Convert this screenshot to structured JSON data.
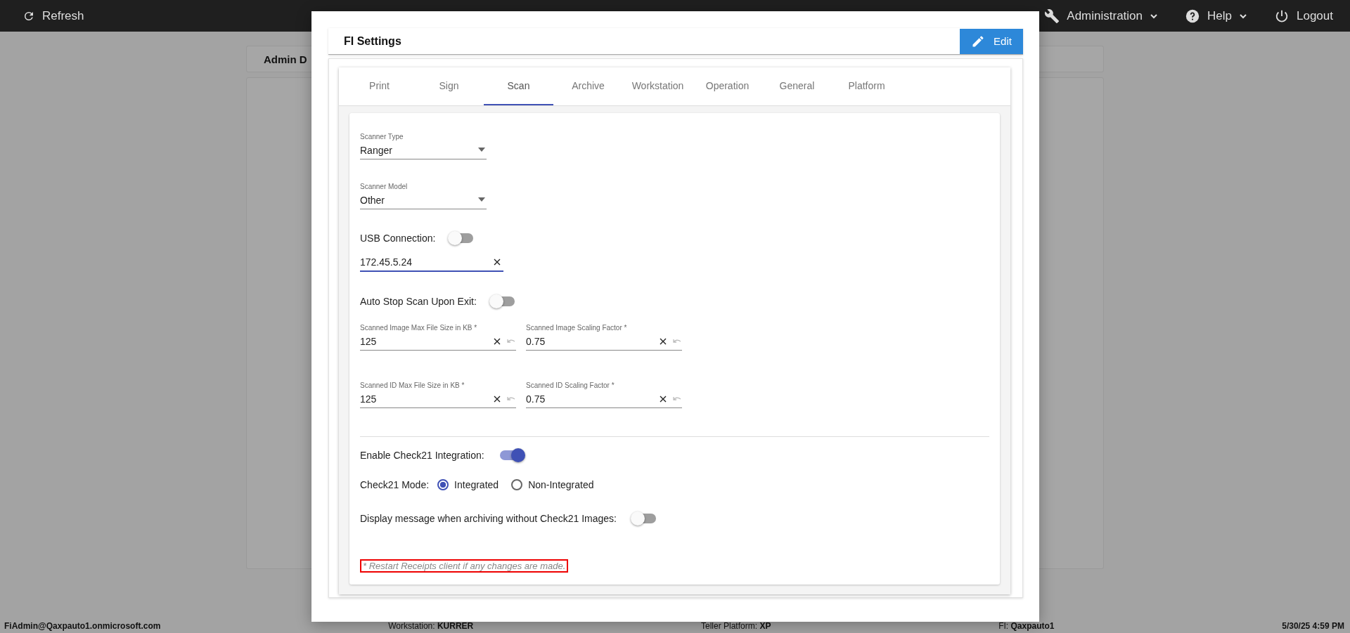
{
  "top_bar": {
    "refresh": "Refresh",
    "menus": [
      {
        "kind": "wrench",
        "label": "Administration",
        "dropdown": true
      },
      {
        "kind": "help",
        "label": "Help",
        "dropdown": true
      },
      {
        "kind": "power",
        "label": "Logout",
        "dropdown": false
      }
    ]
  },
  "background_page": {
    "card_title": "Admin D"
  },
  "modal": {
    "title": "FI Settings",
    "edit_button": "Edit",
    "tabs": [
      {
        "label": "Print",
        "selected": false
      },
      {
        "label": "Sign",
        "selected": false
      },
      {
        "label": "Scan",
        "selected": true
      },
      {
        "label": "Archive",
        "selected": false
      },
      {
        "label": "Workstation",
        "selected": false
      },
      {
        "label": "Operation",
        "selected": false
      },
      {
        "label": "General",
        "selected": false
      },
      {
        "label": "Platform",
        "selected": false
      }
    ],
    "scanner_type": {
      "label": "Scanner Type",
      "value": "Ranger"
    },
    "scanner_model": {
      "label": "Scanner Model",
      "value": "Other"
    },
    "usb_connection": {
      "label": "USB Connection:",
      "on": false
    },
    "ip_address": {
      "value": "172.45.5.24",
      "focused": true
    },
    "auto_stop": {
      "label": "Auto Stop Scan Upon Exit:",
      "on": false
    },
    "size_fields": [
      {
        "label": "Scanned Image Max File Size in KB *",
        "value": "125"
      },
      {
        "label": "Scanned Image Scaling Factor *",
        "value": "0.75"
      },
      {
        "label": "Scanned ID Max File Size in KB *",
        "value": "125"
      },
      {
        "label": "Scanned ID Scaling Factor *",
        "value": "0.75"
      }
    ],
    "check21_integration": {
      "label": "Enable Check21 Integration:",
      "on": true
    },
    "check21_mode": {
      "label": "Check21 Mode:",
      "options": [
        {
          "label": "Integrated",
          "selected": true
        },
        {
          "label": "Non-Integrated",
          "selected": false
        }
      ]
    },
    "display_message": {
      "label": "Display message when archiving without Check21 Images:",
      "on": false
    },
    "note": "* Restart Receipts client if any changes are made."
  },
  "status_bar": {
    "user": "FiAdmin@Qaxpauto1.onmicrosoft.com",
    "workstation": "Workstation: **KURRER**",
    "platform": "Teller Platform: **XP**",
    "fi": "FI: **Qaxpauto1**",
    "datetime": "5/30/25 4:59 PM"
  }
}
